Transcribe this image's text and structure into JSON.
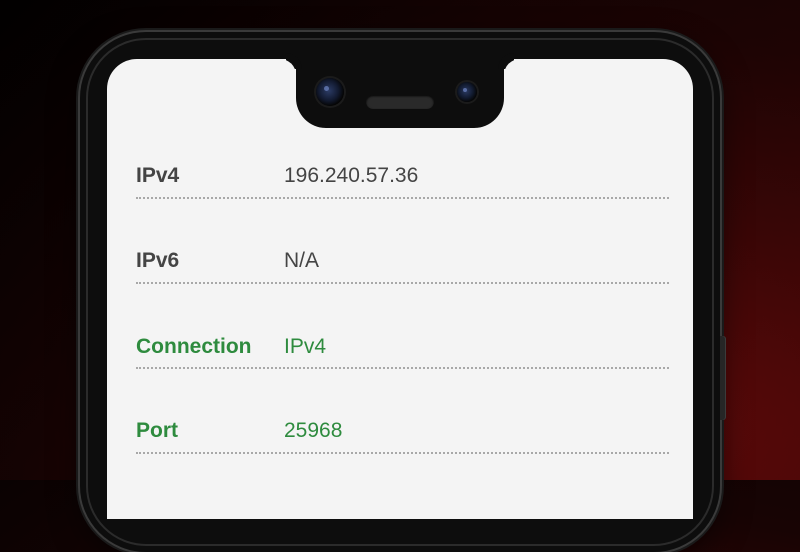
{
  "colors": {
    "background_dark": "#0a0202",
    "background_red": "#6a0a0a",
    "phone_frame": "#0d0d0d",
    "screen_bg": "#f4f4f4",
    "text_default": "#444444",
    "text_accent": "#2e8b3e",
    "divider": "#a8a8a8"
  },
  "rows": [
    {
      "label": "IPv4",
      "value": "196.240.57.36",
      "accent": false
    },
    {
      "label": "IPv6",
      "value": "N/A",
      "accent": false
    },
    {
      "label": "Connection",
      "value": "IPv4",
      "accent": true
    },
    {
      "label": "Port",
      "value": "25968",
      "accent": true
    }
  ]
}
